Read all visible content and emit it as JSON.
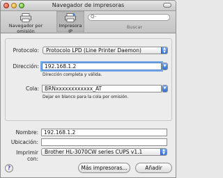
{
  "window": {
    "title": "Navegador de impresoras"
  },
  "toolbar": {
    "default_browser_label": "Navegador por omisión",
    "ip_printer_label": "Impresora IP",
    "search_label": "Buscar",
    "search_placeholder_glyph": "Q-"
  },
  "form": {
    "protocol_label": "Protocolo:",
    "protocol_value": "Protocolo LPD (Line Printer Daemon)",
    "address_label": "Dirección:",
    "address_value": "192.168.1.2",
    "address_hint": "Dirección completa y válida.",
    "queue_label": "Cola:",
    "queue_value": "BRNxxxxxxxxxxxx_AT",
    "queue_hint": "Dejar en blanco para la cola por omisión."
  },
  "details": {
    "name_label": "Nombre:",
    "name_value": "192.168.1.2",
    "location_label": "Ubicación:",
    "location_value": "",
    "print_using_label": "Imprimir con:",
    "print_using_value": "Brother HL-3070CW series CUPS v1.1"
  },
  "footer": {
    "help_glyph": "?",
    "more_printers_label": "Más impresoras...",
    "add_label": "Añadir"
  }
}
